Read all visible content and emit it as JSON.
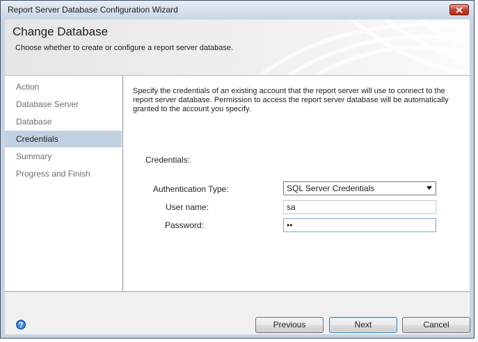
{
  "window": {
    "title": "Report Server Database Configuration Wizard"
  },
  "banner": {
    "heading": "Change Database",
    "subtitle": "Choose whether to create or configure a report server database."
  },
  "steps": [
    {
      "label": "Action"
    },
    {
      "label": "Database Server"
    },
    {
      "label": "Database"
    },
    {
      "label": "Credentials"
    },
    {
      "label": "Summary"
    },
    {
      "label": "Progress and Finish"
    }
  ],
  "active_step": 3,
  "content": {
    "description": "Specify the credentials of an existing account that the report server will use to connect to the report server database.  Permission to access the report server database will be automatically granted to the account you specify.",
    "section_label": "Credentials:",
    "auth_type_label": "Authentication Type:",
    "auth_type_value": "SQL Server Credentials",
    "username_label": "User name:",
    "username_value": "sa",
    "password_label": "Password:",
    "password_value": "••"
  },
  "buttons": {
    "previous": "Previous",
    "next": "Next",
    "cancel": "Cancel"
  },
  "icons": {
    "close": "close-icon",
    "help": "help-icon",
    "dropdown": "chevron-down-icon"
  },
  "colors": {
    "active_step_bg": "#c2d0e2",
    "close_button": "#c4412d",
    "frame": "#c8d4e3"
  }
}
